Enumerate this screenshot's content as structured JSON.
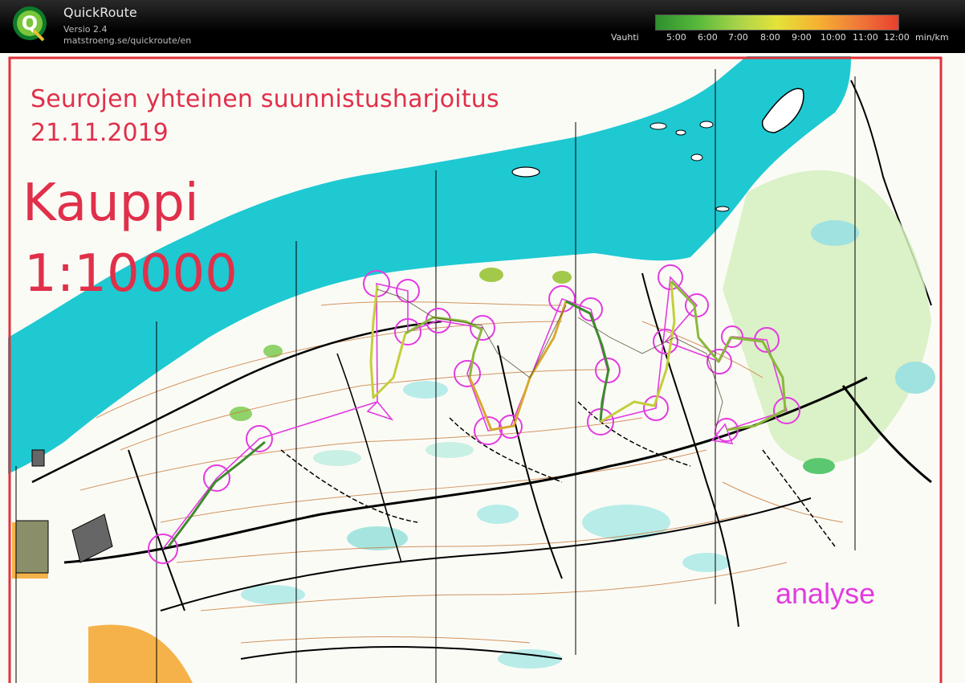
{
  "app": {
    "title": "QuickRoute",
    "version": "Versio 2.4",
    "url": "matstroeng.se/quickroute/en"
  },
  "pace_legend": {
    "label": "Vauhti",
    "ticks": [
      "5:00",
      "6:00",
      "7:00",
      "8:00",
      "9:00",
      "10:00",
      "11:00",
      "12:00"
    ],
    "unit": "min/km",
    "gradient_colors": [
      "#2e8f2e",
      "#55b83a",
      "#a6d34a",
      "#e4e23a",
      "#f5b231",
      "#f07a3a",
      "#e8402e"
    ]
  },
  "map": {
    "title_line1": "Seurojen yhteinen suunnistusharjoitus",
    "title_line2": "21.11.2019",
    "name": "Kauppi",
    "scale": "1:10000",
    "overlay_label": "analyse",
    "colors": {
      "water": "#1ec9d2",
      "border": "#e2323a",
      "text": "#e0304a",
      "course": "#e23be0",
      "open_land": "#f5b24a",
      "green": "#8fd36a"
    }
  }
}
